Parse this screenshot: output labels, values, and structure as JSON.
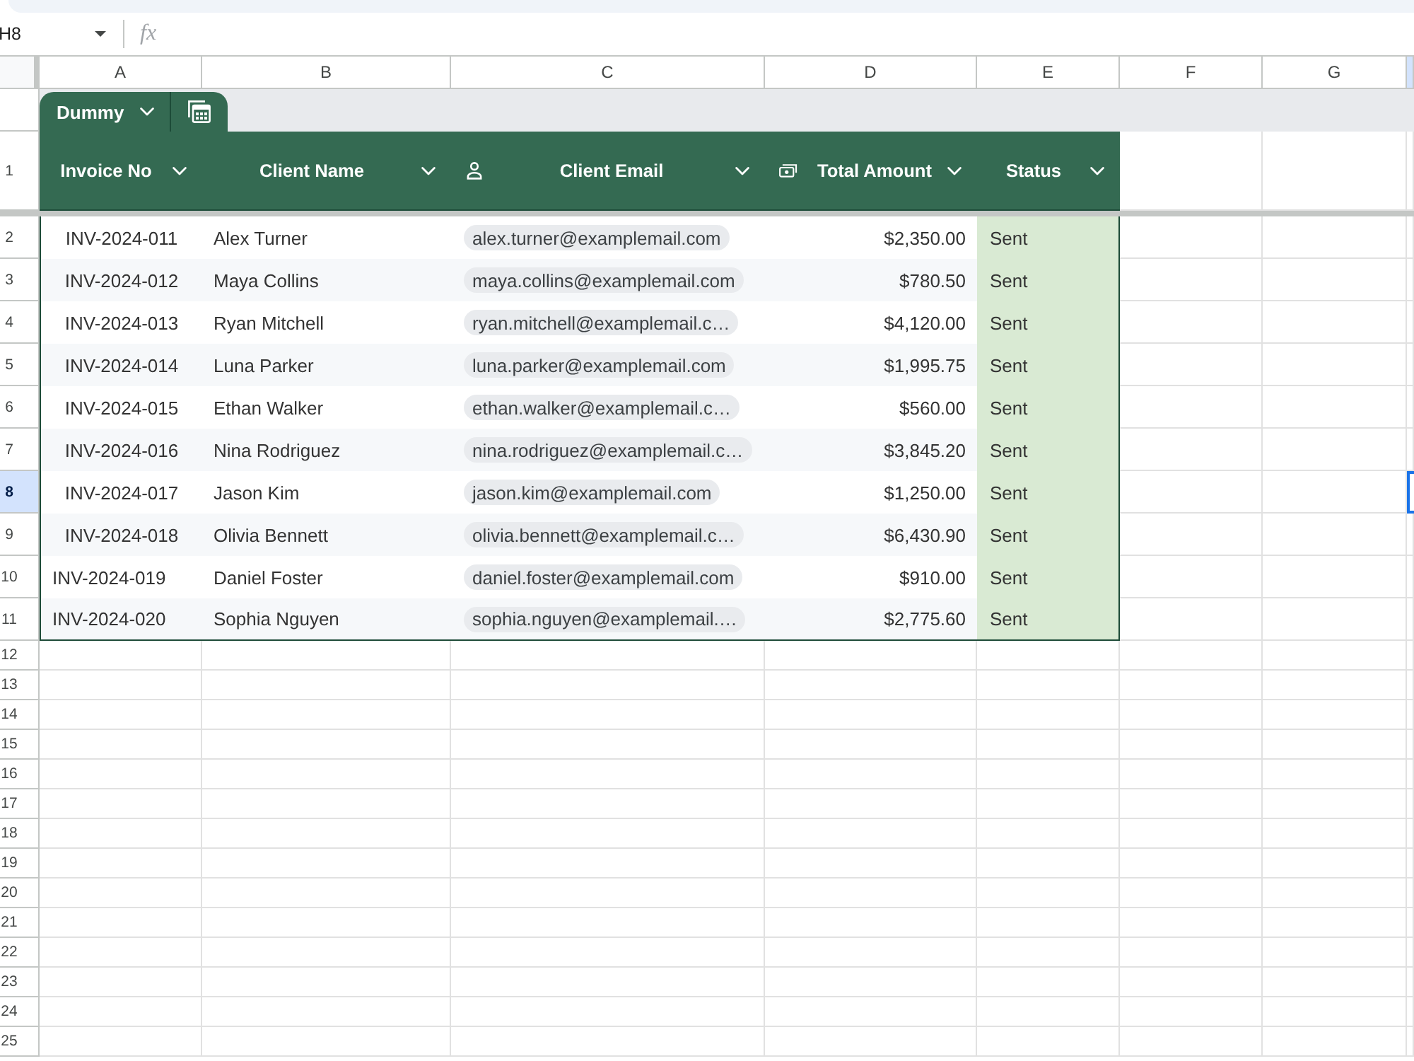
{
  "formula_bar": {
    "name_box": "H8",
    "function_symbol": "fx"
  },
  "columns": [
    {
      "label": "A",
      "selected": false
    },
    {
      "label": "B",
      "selected": false
    },
    {
      "label": "C",
      "selected": false
    },
    {
      "label": "D",
      "selected": false
    },
    {
      "label": "E",
      "selected": false
    },
    {
      "label": "F",
      "selected": false
    },
    {
      "label": "G",
      "selected": false
    },
    {
      "selected": true
    }
  ],
  "row_numbers": [
    {
      "label": "1",
      "selected": false
    },
    {
      "label": "2",
      "selected": false
    },
    {
      "label": "3",
      "selected": false
    },
    {
      "label": "4",
      "selected": false
    },
    {
      "label": "5",
      "selected": false
    },
    {
      "label": "6",
      "selected": false
    },
    {
      "label": "7",
      "selected": false
    },
    {
      "label": "8",
      "selected": true
    },
    {
      "label": "9",
      "selected": false
    },
    {
      "label": "10",
      "selected": false
    },
    {
      "label": "11",
      "selected": false
    },
    {
      "label": "12",
      "selected": false
    },
    {
      "label": "13",
      "selected": false
    },
    {
      "label": "14",
      "selected": false
    },
    {
      "label": "15",
      "selected": false
    },
    {
      "label": "16",
      "selected": false
    },
    {
      "label": "17",
      "selected": false
    },
    {
      "label": "18",
      "selected": false
    },
    {
      "label": "19",
      "selected": false
    },
    {
      "label": "20",
      "selected": false
    },
    {
      "label": "21",
      "selected": false
    },
    {
      "label": "22",
      "selected": false
    },
    {
      "label": "23",
      "selected": false
    },
    {
      "label": "24",
      "selected": false
    },
    {
      "label": "25",
      "selected": false
    }
  ],
  "table": {
    "name": "Dummy",
    "header": [
      {
        "label": "Invoice No",
        "kind": "text"
      },
      {
        "label": "Client Name",
        "kind": "text"
      },
      {
        "label": "Client Email",
        "kind": "person"
      },
      {
        "label": "Total Amount",
        "kind": "currency"
      },
      {
        "label": "Status",
        "kind": "text"
      }
    ],
    "rows": [
      {
        "invoice_no": "INV-2024-011",
        "invoice_left_aligned": false,
        "client_name": "Alex Turner",
        "client_email": "alex.turner@examplemail.com",
        "total_amount": "$2,350.00",
        "status": "Sent"
      },
      {
        "invoice_no": "INV-2024-012",
        "invoice_left_aligned": false,
        "client_name": "Maya Collins",
        "client_email": "maya.collins@examplemail.com",
        "total_amount": "$780.50",
        "status": "Sent"
      },
      {
        "invoice_no": "INV-2024-013",
        "invoice_left_aligned": false,
        "client_name": "Ryan Mitchell",
        "client_email": "ryan.mitchell@examplemail.c…",
        "total_amount": "$4,120.00",
        "status": "Sent"
      },
      {
        "invoice_no": "INV-2024-014",
        "invoice_left_aligned": false,
        "client_name": "Luna Parker",
        "client_email": "luna.parker@examplemail.com",
        "total_amount": "$1,995.75",
        "status": "Sent"
      },
      {
        "invoice_no": "INV-2024-015",
        "invoice_left_aligned": false,
        "client_name": "Ethan Walker",
        "client_email": "ethan.walker@examplemail.c…",
        "total_amount": "$560.00",
        "status": "Sent"
      },
      {
        "invoice_no": "INV-2024-016",
        "invoice_left_aligned": false,
        "client_name": "Nina Rodriguez",
        "client_email": "nina.rodriguez@examplemail.c…",
        "total_amount": "$3,845.20",
        "status": "Sent"
      },
      {
        "invoice_no": "INV-2024-017",
        "invoice_left_aligned": false,
        "client_name": "Jason Kim",
        "client_email": "jason.kim@examplemail.com",
        "total_amount": "$1,250.00",
        "status": "Sent"
      },
      {
        "invoice_no": "INV-2024-018",
        "invoice_left_aligned": false,
        "client_name": "Olivia Bennett",
        "client_email": "olivia.bennett@examplemail.c…",
        "total_amount": "$6,430.90",
        "status": "Sent"
      },
      {
        "invoice_no": "INV-2024-019",
        "invoice_left_aligned": true,
        "client_name": "Daniel Foster",
        "client_email": "daniel.foster@examplemail.com",
        "total_amount": "$910.00",
        "status": "Sent"
      },
      {
        "invoice_no": "INV-2024-020",
        "invoice_left_aligned": true,
        "client_name": "Sophia Nguyen",
        "client_email": "sophia.nguyen@examplemail.…",
        "total_amount": "$2,775.60",
        "status": "Sent"
      }
    ]
  }
}
